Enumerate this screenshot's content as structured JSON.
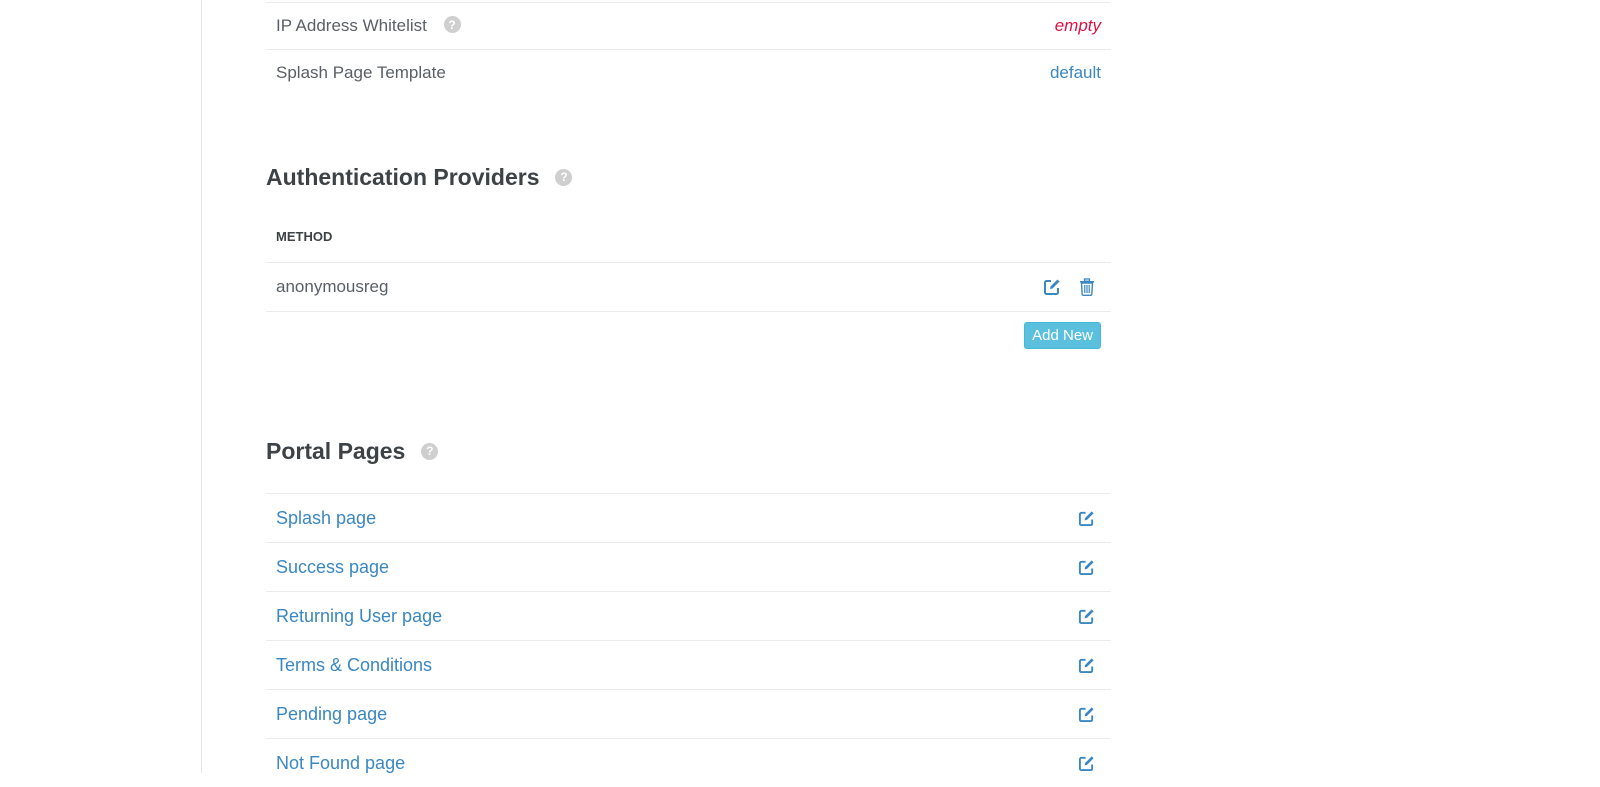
{
  "settings": {
    "rows": [
      {
        "label": "IP Address Whitelist",
        "value": "empty"
      },
      {
        "label": "Splash Page Template",
        "value": "default"
      }
    ]
  },
  "auth_providers": {
    "title": "Authentication Providers",
    "column_header": "METHOD",
    "rows": [
      {
        "method": "anonymousreg"
      }
    ],
    "add_new_label": "Add New"
  },
  "portal_pages": {
    "title": "Portal Pages",
    "items": [
      {
        "label": "Splash page"
      },
      {
        "label": "Success page"
      },
      {
        "label": "Returning User page"
      },
      {
        "label": "Terms & Conditions"
      },
      {
        "label": "Pending page"
      },
      {
        "label": "Not Found page"
      }
    ]
  },
  "icons": {
    "help": "question-circle-icon",
    "edit": "edit-icon",
    "delete": "trash-icon"
  },
  "colors": {
    "link": "#3a87c2",
    "empty_value": "#dd1144",
    "button_info": "#5bc0de",
    "help_icon": "#cfcfcf"
  }
}
